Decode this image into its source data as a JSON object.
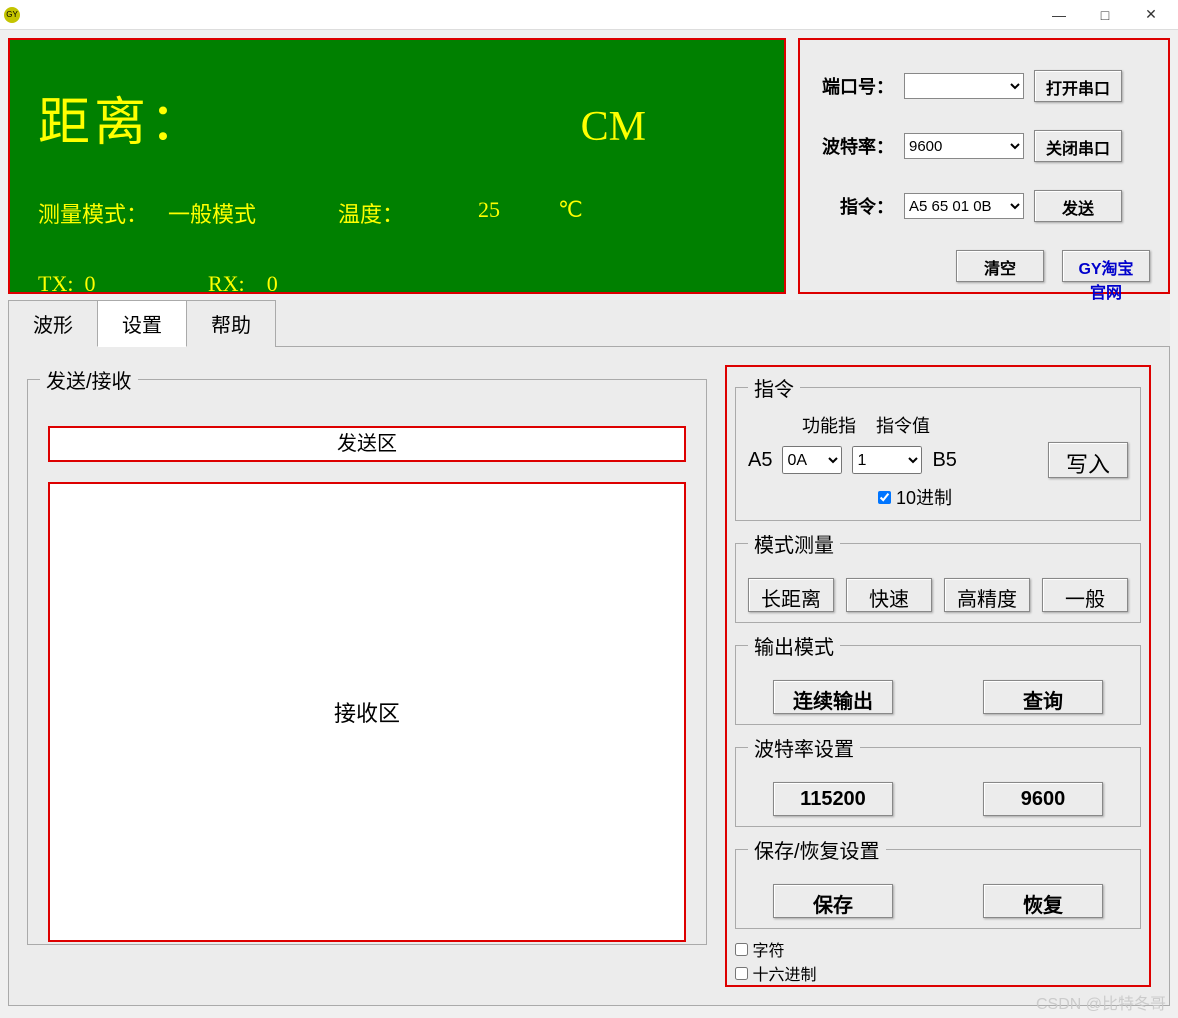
{
  "window": {
    "min": "—",
    "max": "□",
    "close": "✕"
  },
  "display": {
    "distance_label": "距离：",
    "distance_unit": "CM",
    "mode_label": "测量模式：",
    "mode_value": "一般模式",
    "temp_label": "温度：",
    "temp_value": "25",
    "temp_unit": "℃",
    "tx_label": "TX:",
    "tx_value": "0",
    "rx_label": "RX:",
    "rx_value": "0"
  },
  "conn": {
    "port_label": "端口号：",
    "port_value": "",
    "baud_label": "波特率：",
    "baud_value": "9600",
    "cmd_label": "指令：",
    "cmd_value": "A5 65 01 0B",
    "open_btn": "打开串口",
    "close_btn": "关闭串口",
    "send_btn": "发送",
    "clear_btn": "清空",
    "link_btn": "GY淘宝官网"
  },
  "tabs": {
    "t1": "波形",
    "t2": "设置",
    "t3": "帮助"
  },
  "sendrecv": {
    "legend": "发送/接收",
    "send_area": "发送区",
    "recv_area": "接收区"
  },
  "cmd_panel": {
    "legend": "指令",
    "func_head": "功能指",
    "val_head": "指令值",
    "prefix": "A5",
    "func_val": "0A",
    "cmd_val": "1",
    "suffix": "B5",
    "write_btn": "写入",
    "dec_label": "10进制"
  },
  "mode_panel": {
    "legend": "模式测量",
    "b1": "长距离",
    "b2": "快速",
    "b3": "高精度",
    "b4": "一般"
  },
  "output_panel": {
    "legend": "输出模式",
    "b1": "连续输出",
    "b2": "查询"
  },
  "baud_panel": {
    "legend": "波特率设置",
    "b1": "115200",
    "b2": "9600"
  },
  "save_panel": {
    "legend": "保存/恢复设置",
    "b1": "保存",
    "b2": "恢复"
  },
  "checks": {
    "c1": "字符",
    "c2": "十六进制"
  },
  "watermark": "CSDN @比特冬哥"
}
